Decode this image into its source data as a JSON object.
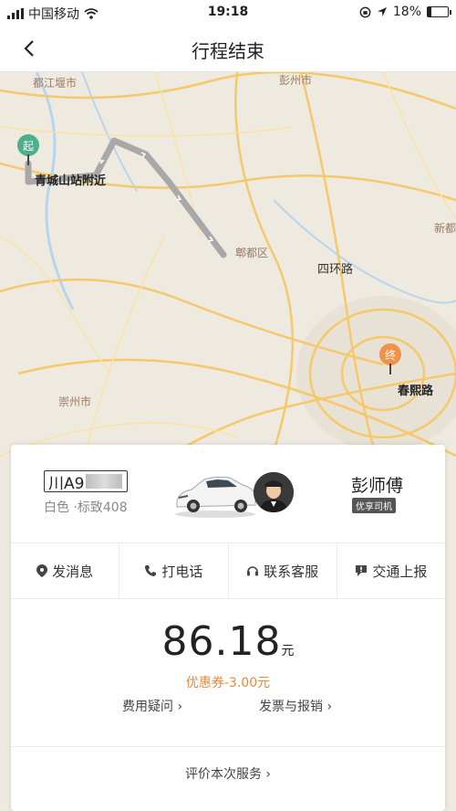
{
  "status_bar": {
    "carrier": "中国移动",
    "time": "19:18",
    "battery": "18%",
    "battery_level": 0.18
  },
  "nav": {
    "title": "行程结束"
  },
  "map": {
    "labels": {
      "dujiangyan": "都江堰市",
      "pengzhou": "彭州市",
      "qingcheng": "青城山站附近",
      "pidu": "郫都区",
      "sihuan": "四环路",
      "chongzhou": "崇州市",
      "chunxi": "春熙路",
      "xindu": "新都"
    },
    "start_pin": "起",
    "end_pin": "终",
    "start_color": "#4fae8d",
    "end_color": "#f0924a",
    "route_color": "#a8a8a8"
  },
  "trip": {
    "plate": "川A9",
    "car_desc": "白色 ·标致408",
    "driver_name": "彭师傅",
    "driver_badge": "优享司机",
    "actions": [
      "发消息",
      "打电话",
      "联系客服",
      "交通上报"
    ],
    "fare": "86.18",
    "fare_unit": "元",
    "coupon": "优惠券-3.00元",
    "fee_question": "费用疑问 ›",
    "invoice": "发票与报销 ›",
    "rate": "评价本次服务 ›",
    "coupon_color": "#e8893b"
  }
}
